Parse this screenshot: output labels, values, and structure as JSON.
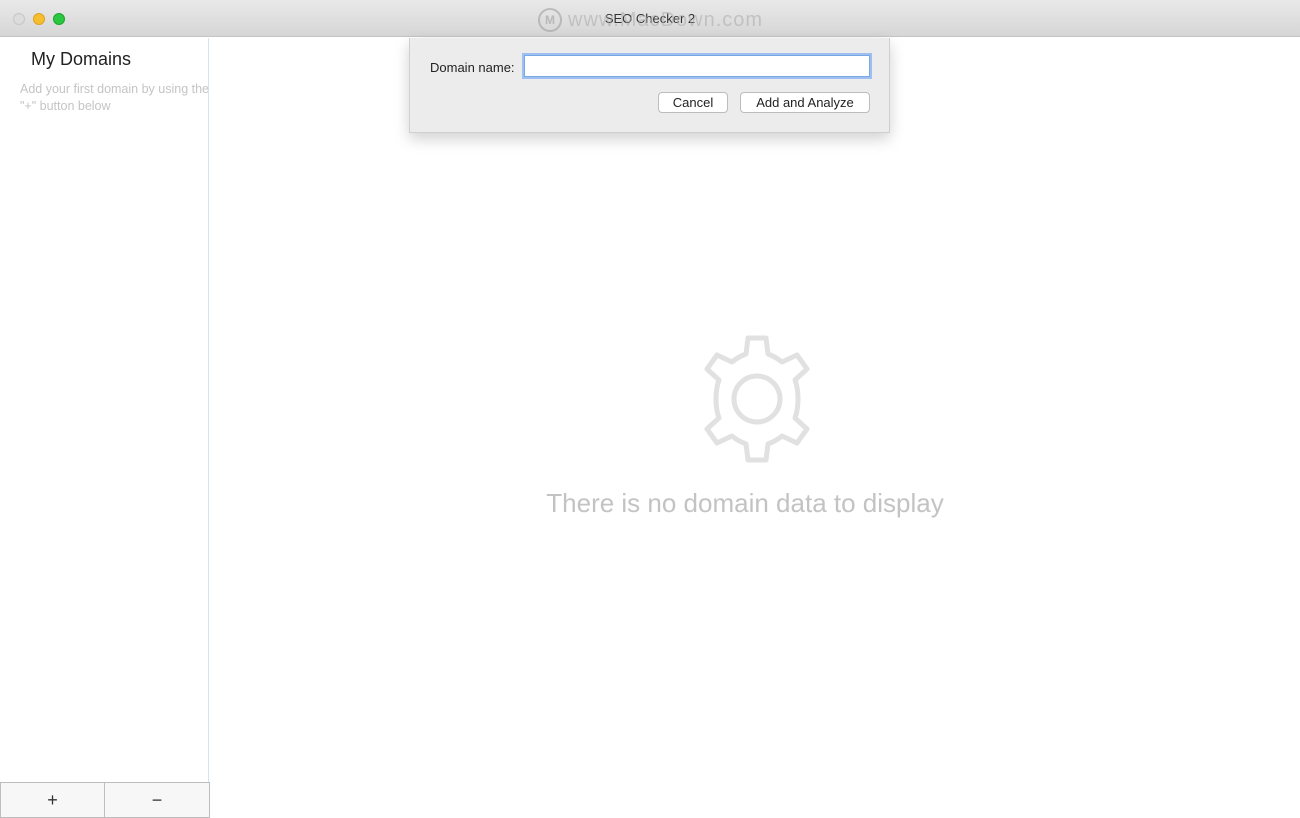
{
  "window": {
    "title": "SEO Checker 2",
    "watermark_text": "www.MacDown.com",
    "watermark_logo": "M"
  },
  "sidebar": {
    "title": "My Domains",
    "hint": "Add your first domain by using the \"+\" button below",
    "add_label": "+",
    "remove_label": "−"
  },
  "main": {
    "empty_icon": "gear-icon",
    "empty_text": "There is no domain data to display"
  },
  "dialog": {
    "field_label": "Domain name:",
    "field_value": "",
    "field_placeholder": "",
    "cancel_label": "Cancel",
    "submit_label": "Add and Analyze"
  },
  "colors": {
    "focus_ring": "#9ec0f0",
    "close": "#dcdcdc",
    "minimize": "#f6be2f",
    "maximize": "#2ac840",
    "empty_text": "#c3c3c3"
  }
}
